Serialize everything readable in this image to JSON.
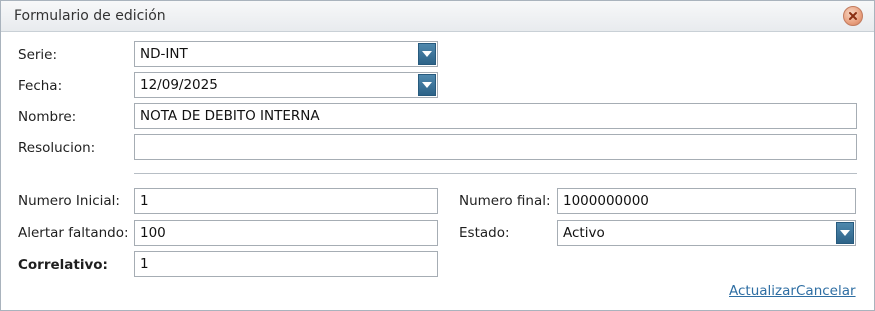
{
  "dialog": {
    "title": "Formulario de edición"
  },
  "form": {
    "serie": {
      "label": "Serie:",
      "value": "ND-INT"
    },
    "fecha": {
      "label": "Fecha:",
      "value": "12/09/2025"
    },
    "nombre": {
      "label": "Nombre:",
      "value": "NOTA DE DEBITO INTERNA"
    },
    "resolucion": {
      "label": "Resolucion:",
      "value": ""
    },
    "numero_inicial": {
      "label": "Numero Inicial:",
      "value": "1"
    },
    "numero_final": {
      "label": "Numero final:",
      "value": "1000000000"
    },
    "alertar_faltando": {
      "label": "Alertar faltando:",
      "value": "100"
    },
    "estado": {
      "label": "Estado:",
      "value": "Activo"
    },
    "correlativo": {
      "label": "Correlativo:",
      "value": "1"
    }
  },
  "actions": {
    "update_label": "Actualizar",
    "cancel_label": "Cancelar"
  },
  "colors": {
    "dropdown_button": "#2d6388",
    "link": "#2e6ea3",
    "close_button": "#e9a07f"
  },
  "icons": {
    "close": "close-icon",
    "dropdown": "chevron-down-icon"
  }
}
